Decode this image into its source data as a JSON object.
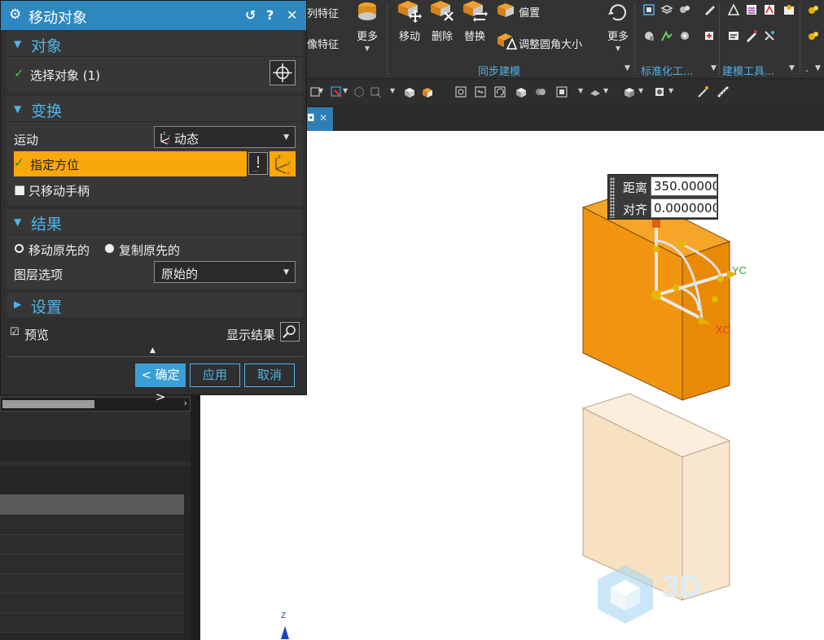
{
  "dialog": {
    "title": "移动对象",
    "titlebar_buttons": [
      "↺",
      "?",
      "✕"
    ],
    "sections": {
      "object": {
        "title": "对象",
        "select_label": "选择对象 (1)"
      },
      "transform": {
        "title": "变换",
        "motion_label": "运动",
        "motion_value": "动态",
        "orient_label": "指定方位",
        "move_handle_label": "只移动手柄"
      },
      "result": {
        "title": "结果",
        "move_original": "移动原先的",
        "copy_original": "复制原先的",
        "layer_label": "图层选项",
        "layer_value": "原始的"
      },
      "settings": {
        "title": "设置"
      }
    },
    "preview_label": "预览",
    "show_result_label": "显示结果",
    "buttons": {
      "ok": "< 确定 >",
      "apply": "应用",
      "cancel": "取消"
    }
  },
  "ribbon": {
    "text_items": [
      "列特征",
      "像特征"
    ],
    "more_label_1": "更多",
    "move_label": "移动",
    "delete_label": "删除",
    "replace_label": "替换",
    "offset_label": "偏置",
    "adjust_blend_label": "调整圆角大小",
    "more_label_2": "更多",
    "groups": {
      "sync_modeling": "同步建模",
      "standardize": "标准化工...",
      "build_tools": "建模工具...",
      "dot": "."
    }
  },
  "viewport": {
    "distance_label": "距离",
    "distance_value": "350.00000",
    "align_label": "对齐",
    "align_value": "0.0000000",
    "yc_label": "YC",
    "xc_label": "XC",
    "z_label": "Z",
    "watermark": "3D"
  },
  "colors": {
    "accent_blue": "#2e87bf",
    "orange_highlight": "#f9a80b",
    "block_orange": "#f19510",
    "block_ghost": "#f7e1c1",
    "check_green": "#54c64a"
  }
}
